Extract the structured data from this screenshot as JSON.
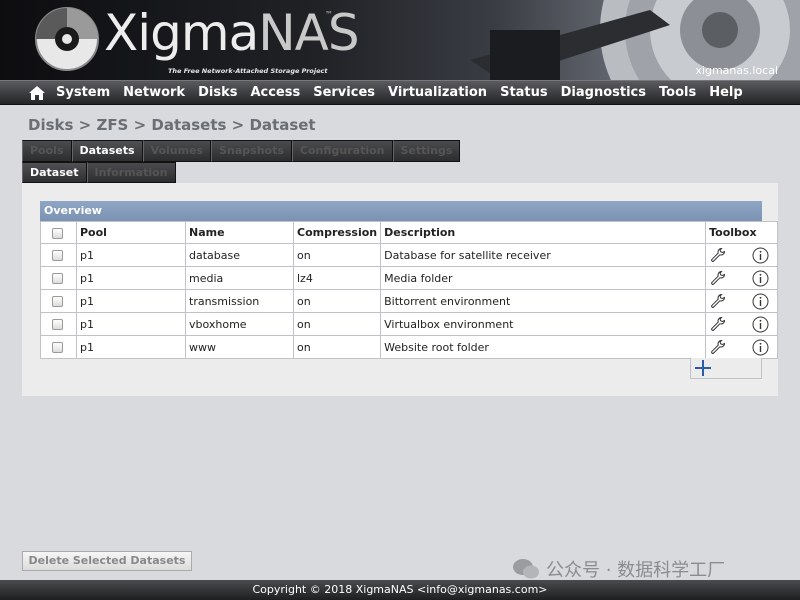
{
  "header": {
    "brand_light": "Xigma",
    "brand_dark": "NAS",
    "trademark": "™",
    "tagline": "The Free Network-Attached Storage Project",
    "hostname": "xigmanas.local"
  },
  "menu": [
    "System",
    "Network",
    "Disks",
    "Access",
    "Services",
    "Virtualization",
    "Status",
    "Diagnostics",
    "Tools",
    "Help"
  ],
  "breadcrumb": "Disks > ZFS > Datasets > Dataset",
  "tabs_primary": [
    {
      "label": "Pools",
      "active": false
    },
    {
      "label": "Datasets",
      "active": true
    },
    {
      "label": "Volumes",
      "active": false
    },
    {
      "label": "Snapshots",
      "active": false
    },
    {
      "label": "Configuration",
      "active": false
    },
    {
      "label": "Settings",
      "active": false
    }
  ],
  "tabs_secondary": [
    {
      "label": "Dataset",
      "active": true
    },
    {
      "label": "Information",
      "active": false
    }
  ],
  "overview": {
    "title": "Overview",
    "columns": [
      "Pool",
      "Name",
      "Compression",
      "Description",
      "Toolbox"
    ],
    "rows": [
      {
        "pool": "p1",
        "name": "database",
        "compression": "on",
        "description": "Database for satellite receiver"
      },
      {
        "pool": "p1",
        "name": "media",
        "compression": "lz4",
        "description": "Media folder"
      },
      {
        "pool": "p1",
        "name": "transmission",
        "compression": "on",
        "description": "Bittorrent environment"
      },
      {
        "pool": "p1",
        "name": "vboxhome",
        "compression": "on",
        "description": "Virtualbox environment"
      },
      {
        "pool": "p1",
        "name": "www",
        "compression": "on",
        "description": "Website root folder"
      }
    ]
  },
  "actions": {
    "delete_label": "Delete Selected Datasets"
  },
  "watermark": "公众号 · 数据科学工厂",
  "footer": "Copyright © 2018 XigmaNAS <info@xigmanas.com>",
  "colors": {
    "overview_header": "#8fa6c4",
    "add_icon": "#2a5caa",
    "menubar": "#2f3033"
  }
}
